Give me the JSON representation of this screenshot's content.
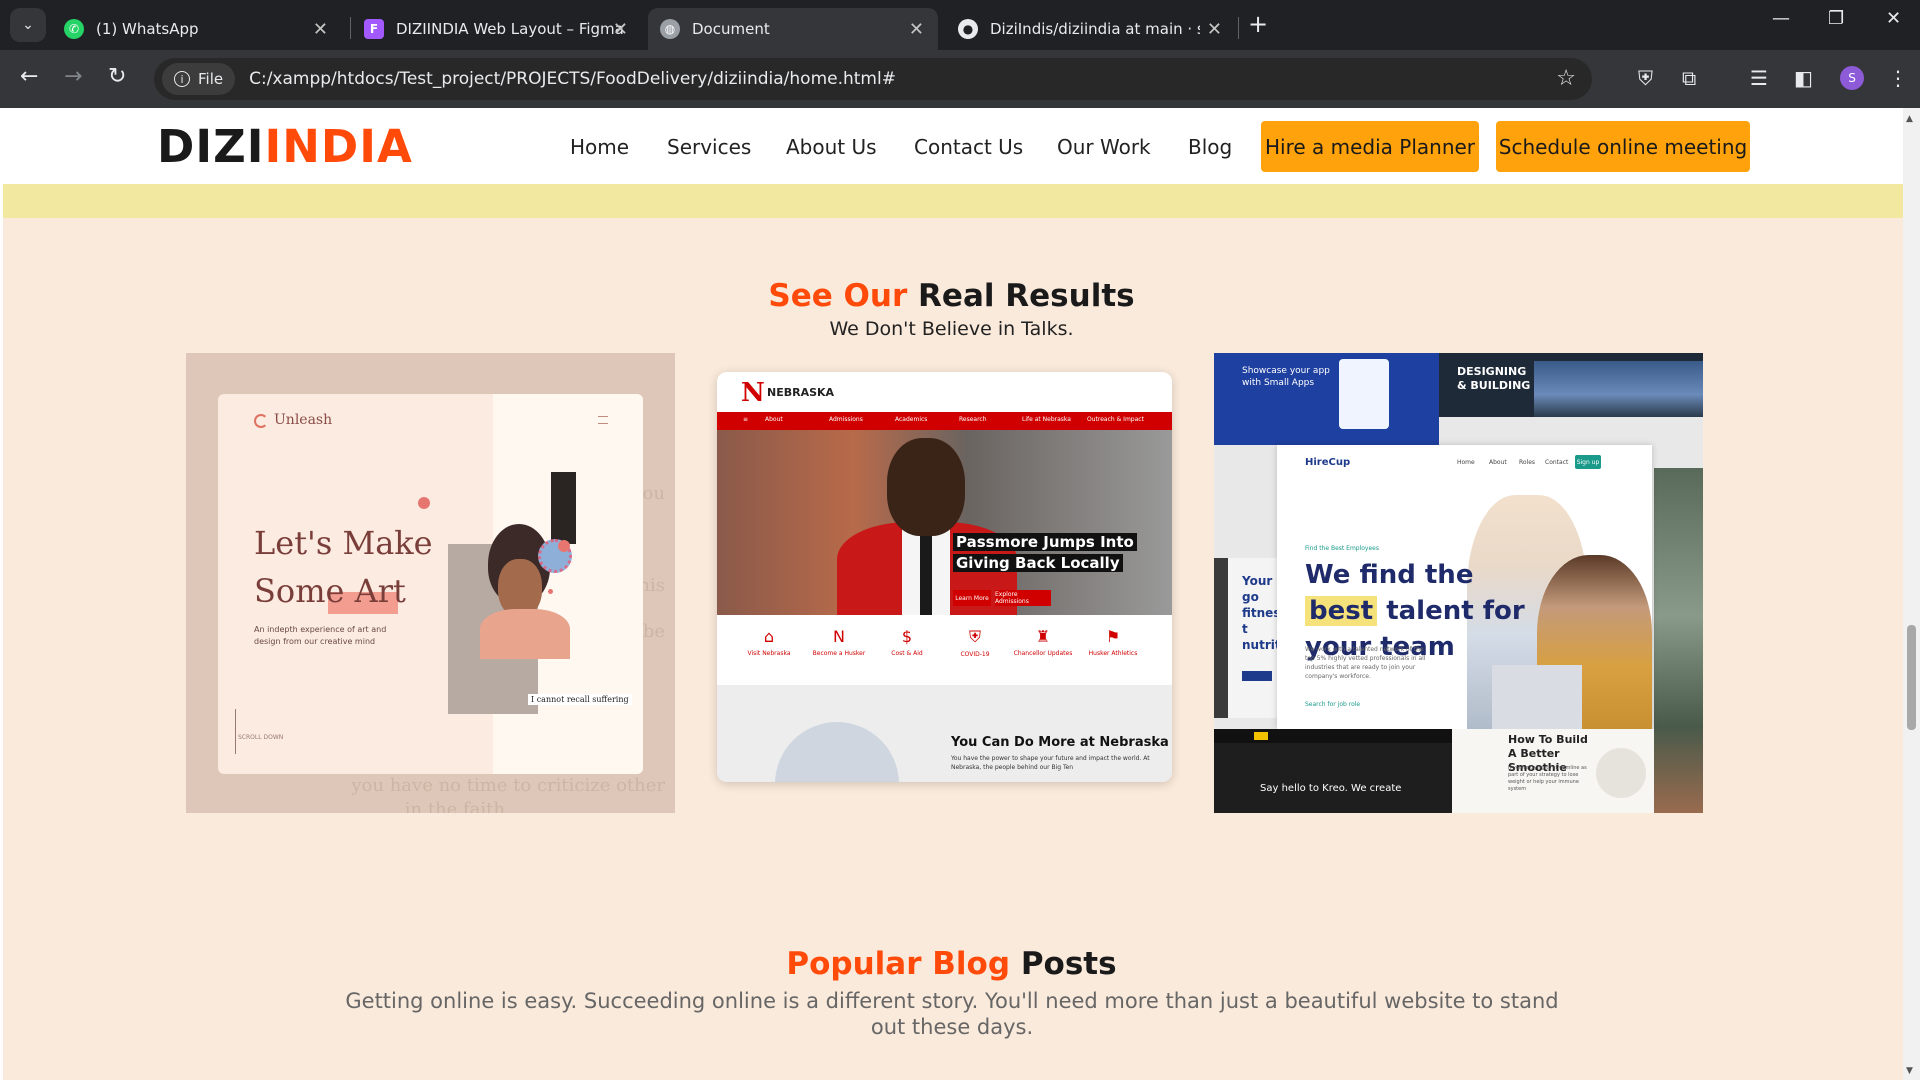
{
  "browser": {
    "tabs": [
      {
        "title": "(1) WhatsApp",
        "icon": "whatsapp-icon",
        "active": false
      },
      {
        "title": "DIZIINDIA Web Layout – Figma",
        "icon": "figma-icon",
        "active": false
      },
      {
        "title": "Document",
        "icon": "globe-icon",
        "active": true
      },
      {
        "title": "DiziIndis/diziindia at main · shar",
        "icon": "github-icon",
        "active": false
      }
    ],
    "address": {
      "chip_label": "File",
      "url": "C:/xampp/htdocs/Test_project/PROJECTS/FoodDelivery/diziindia/home.html#"
    },
    "profile_initial": "S",
    "colors": {
      "chrome_dark": "#202124",
      "toolbar": "#35363a"
    }
  },
  "site": {
    "logo": {
      "part1": "DIZI",
      "part2": "INDIA"
    },
    "nav": [
      "Home",
      "Services",
      "About Us",
      "Contact Us",
      "Our Work",
      "Blog"
    ],
    "cta_primary": "Hire a media Planner",
    "cta_secondary": "Schedule online meeting",
    "colors": {
      "accent": "#ff4a0a",
      "cta": "#ffa20b",
      "page_bg": "#faeadb",
      "strip": "#f3e8a0"
    }
  },
  "results": {
    "title_accent": "See Our",
    "title_rest": " Real Results",
    "subtitle": "We Don't Believe in Talks."
  },
  "showcase": {
    "art": {
      "brand": "Unleash",
      "headline_1": "Let's Make",
      "headline_2": "Some Art",
      "desc": "An indepth experience of art and design from our creative mind",
      "scroll": "SCROLL DOWN",
      "note": "I cannot recall suffering",
      "bg_lines": [
        "you have no time to criticize other",
        "in the faith",
        "trou",
        "This",
        "be"
      ]
    },
    "nebraska": {
      "logo_letter": "N",
      "name": "NEBRASKA",
      "nav": [
        "About",
        "Admissions",
        "Academics",
        "Research",
        "Life at Nebraska",
        "Outreach & Impact"
      ],
      "headline": "Passmore Jumps Into Giving Back Locally",
      "btn_learn": "Learn More",
      "btn_explore": "Explore Admissions",
      "quick_links": [
        {
          "icon": "map-icon",
          "glyph": "⌂",
          "label": "Visit Nebraska"
        },
        {
          "icon": "n-icon",
          "glyph": "N",
          "label": "Become a Husker"
        },
        {
          "icon": "cost-icon",
          "glyph": "$",
          "label": "Cost & Aid"
        },
        {
          "icon": "shield-icon",
          "glyph": "⛨",
          "label": "COVID-19"
        },
        {
          "icon": "lamp-icon",
          "glyph": "♜",
          "label": "Chancellor Updates"
        },
        {
          "icon": "flag-icon",
          "glyph": "⚑",
          "label": "Husker Athletics"
        }
      ],
      "bottom_title": "You Can Do More at Nebraska",
      "bottom_text": "You have the power to shape your future and impact the world. At Nebraska, the people behind our Big Ten"
    },
    "collage": {
      "top_left": "Showcase your app with Small Apps",
      "top_mid": "DESIGNING & BUILDING",
      "left_mid": "Your go fitness t nutrition",
      "hirecup_logo": "HireCup",
      "hirecup_nav": [
        "Home",
        "About",
        "Roles",
        "Contact"
      ],
      "hirecup_signup": "Sign up",
      "hirecup_small": "Find the Best Employees",
      "hirecup_h1_a": "We find the ",
      "hirecup_h1_best": "best",
      "hirecup_h1_b": " talent for your team",
      "hirecup_p": "We work with a talented network of the top 5% highly vetted professionals in all industries that are ready to join your company's workforce.",
      "hirecup_link": "Search for job role",
      "smoothie_title": "How To Build A Better Smoothie",
      "smoothie_text": "If you're trying to streamline as part of your strategy to lose weight or help your immune system",
      "kreo_text": "Say hello to Kreo. We create"
    }
  },
  "blog": {
    "title_accent": "Popular Blog",
    "title_rest": " Posts",
    "subtitle": "Getting online is easy. Succeeding online is a different story. You'll need more than just a beautiful website to stand out these days."
  }
}
